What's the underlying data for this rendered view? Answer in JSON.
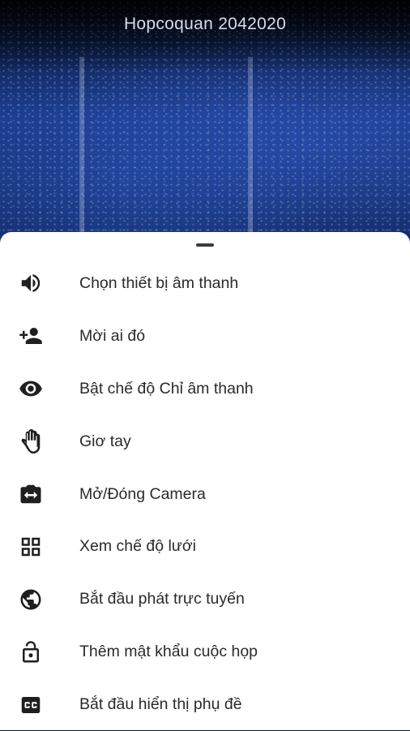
{
  "meeting": {
    "title": "Hopcoquan 2042020"
  },
  "menu": {
    "items": [
      {
        "label": "Chọn thiết bị âm thanh",
        "icon": "volume-icon"
      },
      {
        "label": "Mời ai đó",
        "icon": "add-person-icon"
      },
      {
        "label": "Bật chế độ Chỉ âm thanh",
        "icon": "eye-icon"
      },
      {
        "label": "Giơ tay",
        "icon": "hand-icon"
      },
      {
        "label": "Mở/Đóng Camera",
        "icon": "camera-switch-icon"
      },
      {
        "label": "Xem chế độ lưới",
        "icon": "grid-icon"
      },
      {
        "label": "Bắt đầu phát trực tuyến",
        "icon": "globe-icon"
      },
      {
        "label": "Thêm mật khẩu cuộc họp",
        "icon": "lock-icon"
      },
      {
        "label": "Bắt đầu hiển thị phụ đề",
        "icon": "closed-caption-icon"
      }
    ]
  }
}
